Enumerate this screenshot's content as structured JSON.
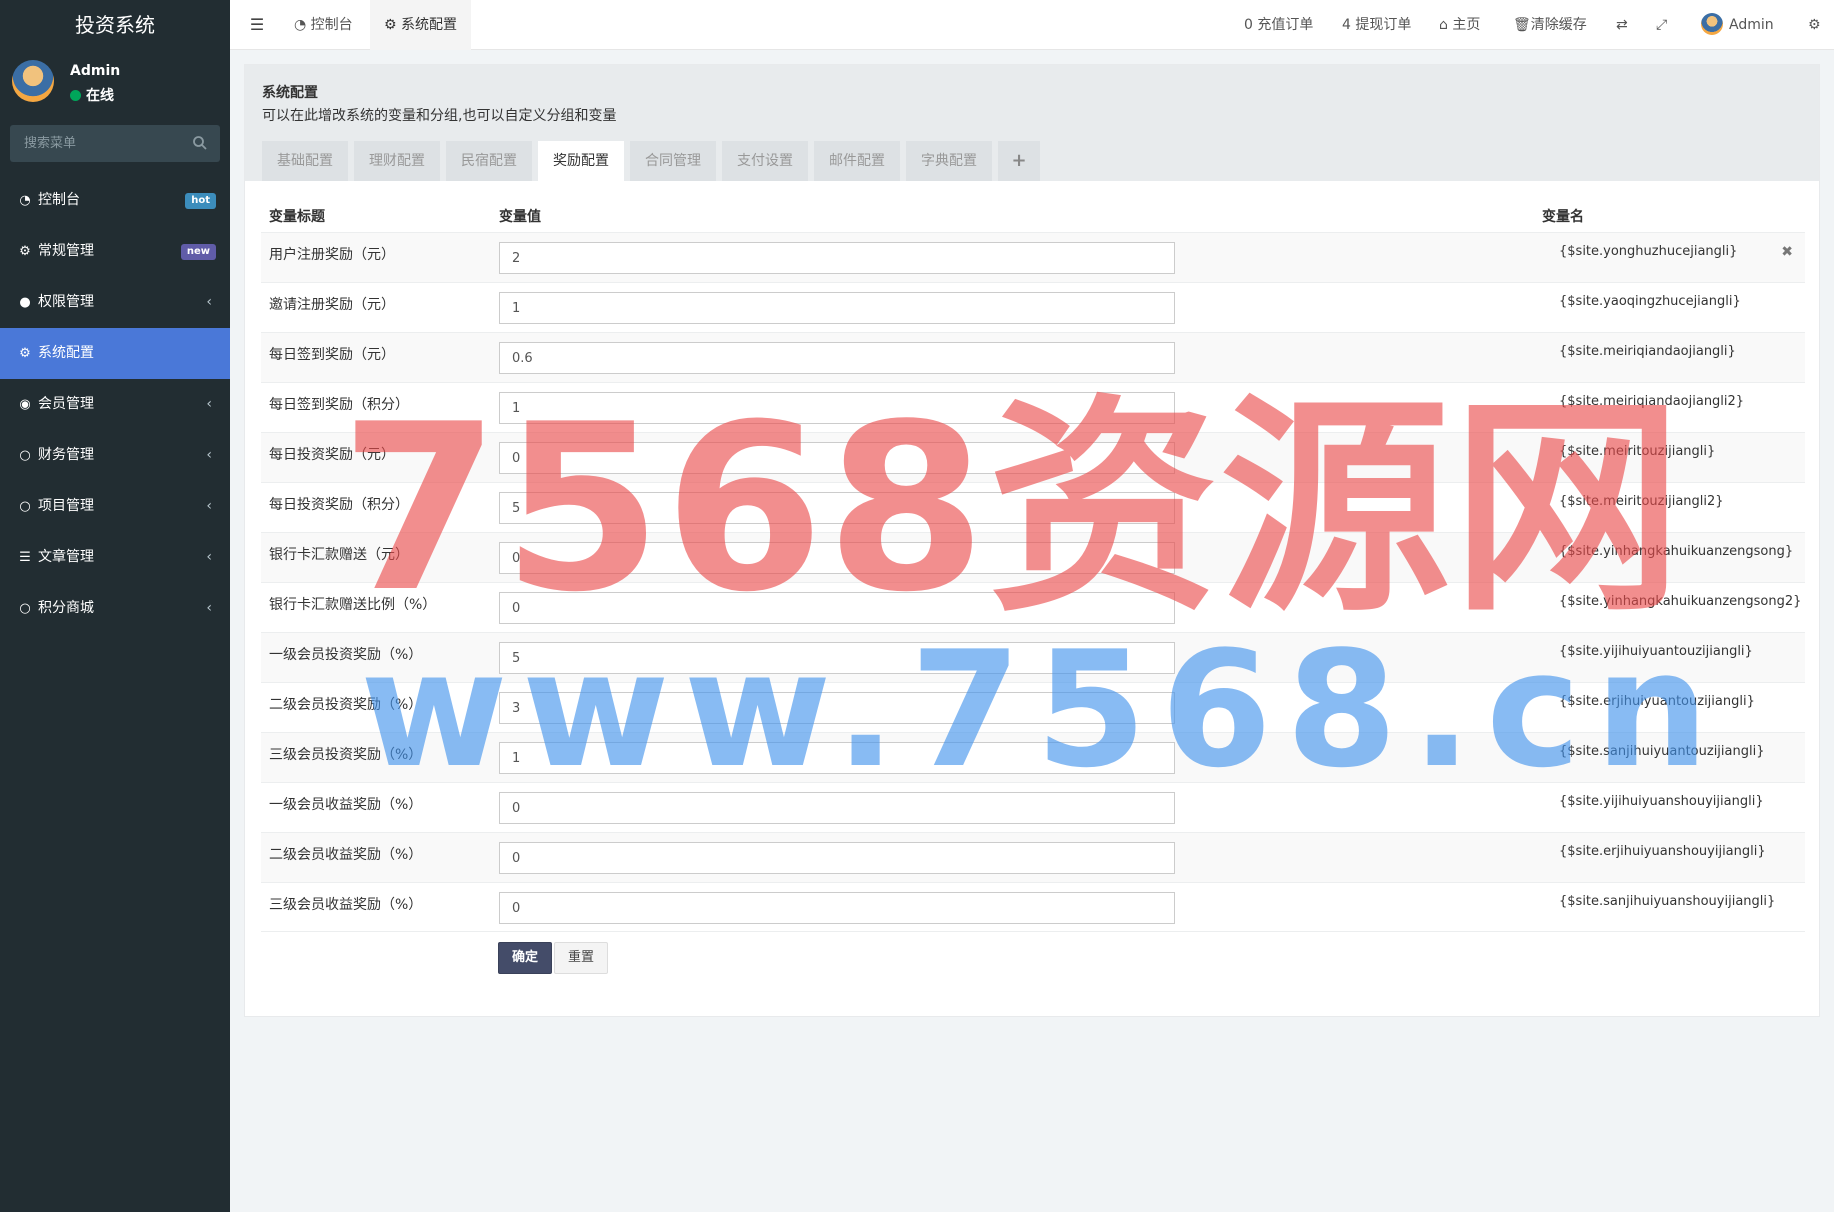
{
  "sidebar": {
    "brand": "投资系统",
    "user": {
      "name": "Admin",
      "status": "在线"
    },
    "search_placeholder": "搜索菜单",
    "items": [
      {
        "label": "控制台",
        "icon": "dashboard-icon",
        "badge": "hot"
      },
      {
        "label": "常规管理",
        "icon": "cogs-icon",
        "badge": "new"
      },
      {
        "label": "权限管理",
        "icon": "users-icon",
        "caret": true
      },
      {
        "label": "系统配置",
        "icon": "gear-icon",
        "active": true
      },
      {
        "label": "会员管理",
        "icon": "user-circle-icon",
        "caret": true
      },
      {
        "label": "财务管理",
        "icon": "circle-icon",
        "caret": true
      },
      {
        "label": "项目管理",
        "icon": "circle-icon",
        "caret": true
      },
      {
        "label": "文章管理",
        "icon": "list-icon",
        "caret": true
      },
      {
        "label": "积分商城",
        "icon": "circle-icon",
        "caret": true
      }
    ]
  },
  "topbar": {
    "tabs": [
      {
        "label": "控制台",
        "icon": "dashboard-icon"
      },
      {
        "label": "系统配置",
        "icon": "gear-icon",
        "active": true
      }
    ],
    "links": {
      "recharge": "0 充值订单",
      "withdraw": "4 提现订单",
      "home": "主页",
      "clear_cache": "清除缓存",
      "user": "Admin"
    }
  },
  "panel": {
    "title": "系统配置",
    "description": "可以在此增改系统的变量和分组,也可以自定义分组和变量",
    "tabs": [
      "基础配置",
      "理财配置",
      "民宿配置",
      "奖励配置",
      "合同管理",
      "支付设置",
      "邮件配置",
      "字典配置"
    ],
    "active_tab": 3,
    "add_tab": "+"
  },
  "table": {
    "headers": {
      "title": "变量标题",
      "value": "变量值",
      "name": "变量名"
    },
    "rows": [
      {
        "label": "用户注册奖励（元）",
        "value": "2",
        "var": "{$site.yonghuzhucejiangli}"
      },
      {
        "label": "邀请注册奖励（元）",
        "value": "1",
        "var": "{$site.yaoqingzhucejiangli}"
      },
      {
        "label": "每日签到奖励（元）",
        "value": "0.6",
        "var": "{$site.meiriqiandaojiangli}"
      },
      {
        "label": "每日签到奖励（积分）",
        "value": "1",
        "var": "{$site.meiriqiandaojiangli2}"
      },
      {
        "label": "每日投资奖励（元）",
        "value": "0",
        "var": "{$site.meiritouzijiangli}"
      },
      {
        "label": "每日投资奖励（积分）",
        "value": "5",
        "var": "{$site.meiritouzijiangli2}"
      },
      {
        "label": "银行卡汇款赠送（元）",
        "value": "0",
        "var": "{$site.yinhangkahuikuanzengsong}"
      },
      {
        "label": "银行卡汇款赠送比例（%）",
        "value": "0",
        "var": "{$site.yinhangkahuikuanzengsong2}"
      },
      {
        "label": "一级会员投资奖励（%）",
        "value": "5",
        "var": "{$site.yijihuiyuantouzijiangli}"
      },
      {
        "label": "二级会员投资奖励（%）",
        "value": "3",
        "var": "{$site.erjihuiyuantouzijiangli}"
      },
      {
        "label": "三级会员投资奖励（%）",
        "value": "1",
        "var": "{$site.sanjihuiyuantouzijiangli}"
      },
      {
        "label": "一级会员收益奖励（%）",
        "value": "0",
        "var": "{$site.yijihuiyuanshouyijiangli}"
      },
      {
        "label": "二级会员收益奖励（%）",
        "value": "0",
        "var": "{$site.erjihuiyuanshouyijiangli}"
      },
      {
        "label": "三级会员收益奖励（%）",
        "value": "0",
        "var": "{$site.sanjihuiyuanshouyijiangli}"
      }
    ]
  },
  "buttons": {
    "confirm": "确定",
    "reset": "重置"
  },
  "watermark": {
    "line1": "7568资源网",
    "line2": "www.7568.cn"
  }
}
